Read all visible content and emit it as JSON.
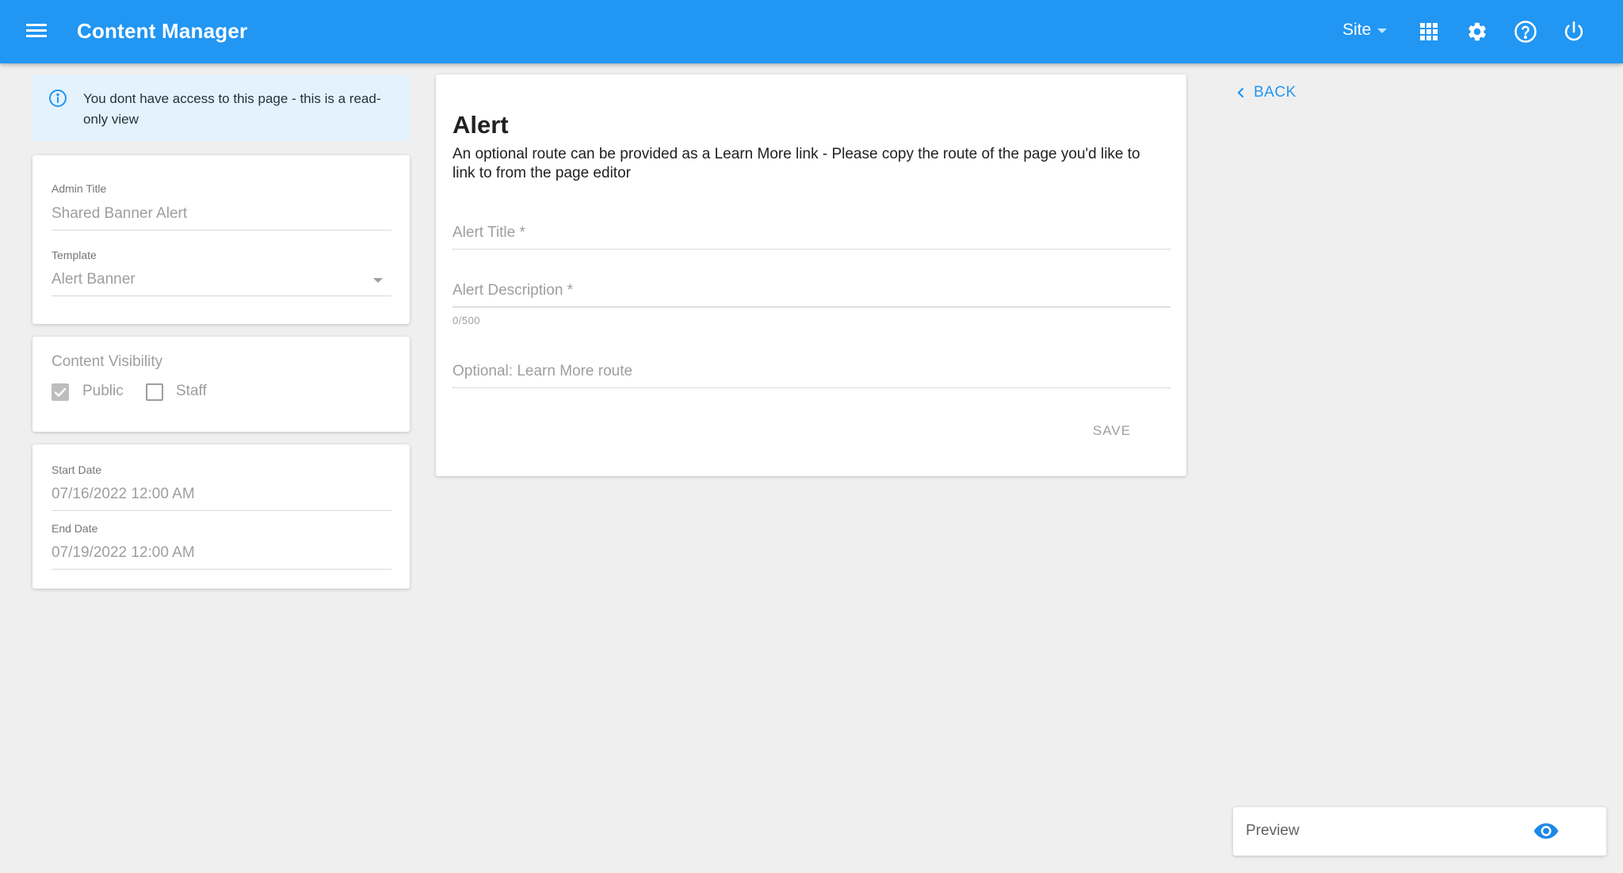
{
  "header": {
    "title": "Content Manager",
    "site_menu_label": "Site",
    "icons": [
      "menu-icon",
      "apps-grid-icon",
      "gear-icon",
      "help-icon",
      "power-icon"
    ],
    "accent_color": "#2196f3"
  },
  "notice": {
    "text": "You dont have access to this page - this is a read-only view"
  },
  "general": {
    "admin_title_label": "Admin Title",
    "admin_title_value": "Shared Banner Alert",
    "template_label": "Template",
    "template_value": "Alert Banner"
  },
  "visibility": {
    "heading": "Content Visibility",
    "options": [
      {
        "label": "Public",
        "checked": true
      },
      {
        "label": "Staff",
        "checked": false
      }
    ]
  },
  "dates": {
    "start_label": "Start Date",
    "start_value": "07/16/2022 12:00 AM",
    "end_label": "End Date",
    "end_value": "07/19/2022 12:00 AM"
  },
  "alert_form": {
    "heading": "Alert",
    "description": "An optional route can be provided as a Learn More link - Please copy the route of the page you'd like to link to from the page editor",
    "title_placeholder": "Alert Title *",
    "description_placeholder": "Alert Description *",
    "description_counter": "0/500",
    "route_placeholder": "Optional: Learn More route",
    "save_label": "SAVE"
  },
  "nav": {
    "back_label": "BACK"
  },
  "preview": {
    "label": "Preview"
  }
}
